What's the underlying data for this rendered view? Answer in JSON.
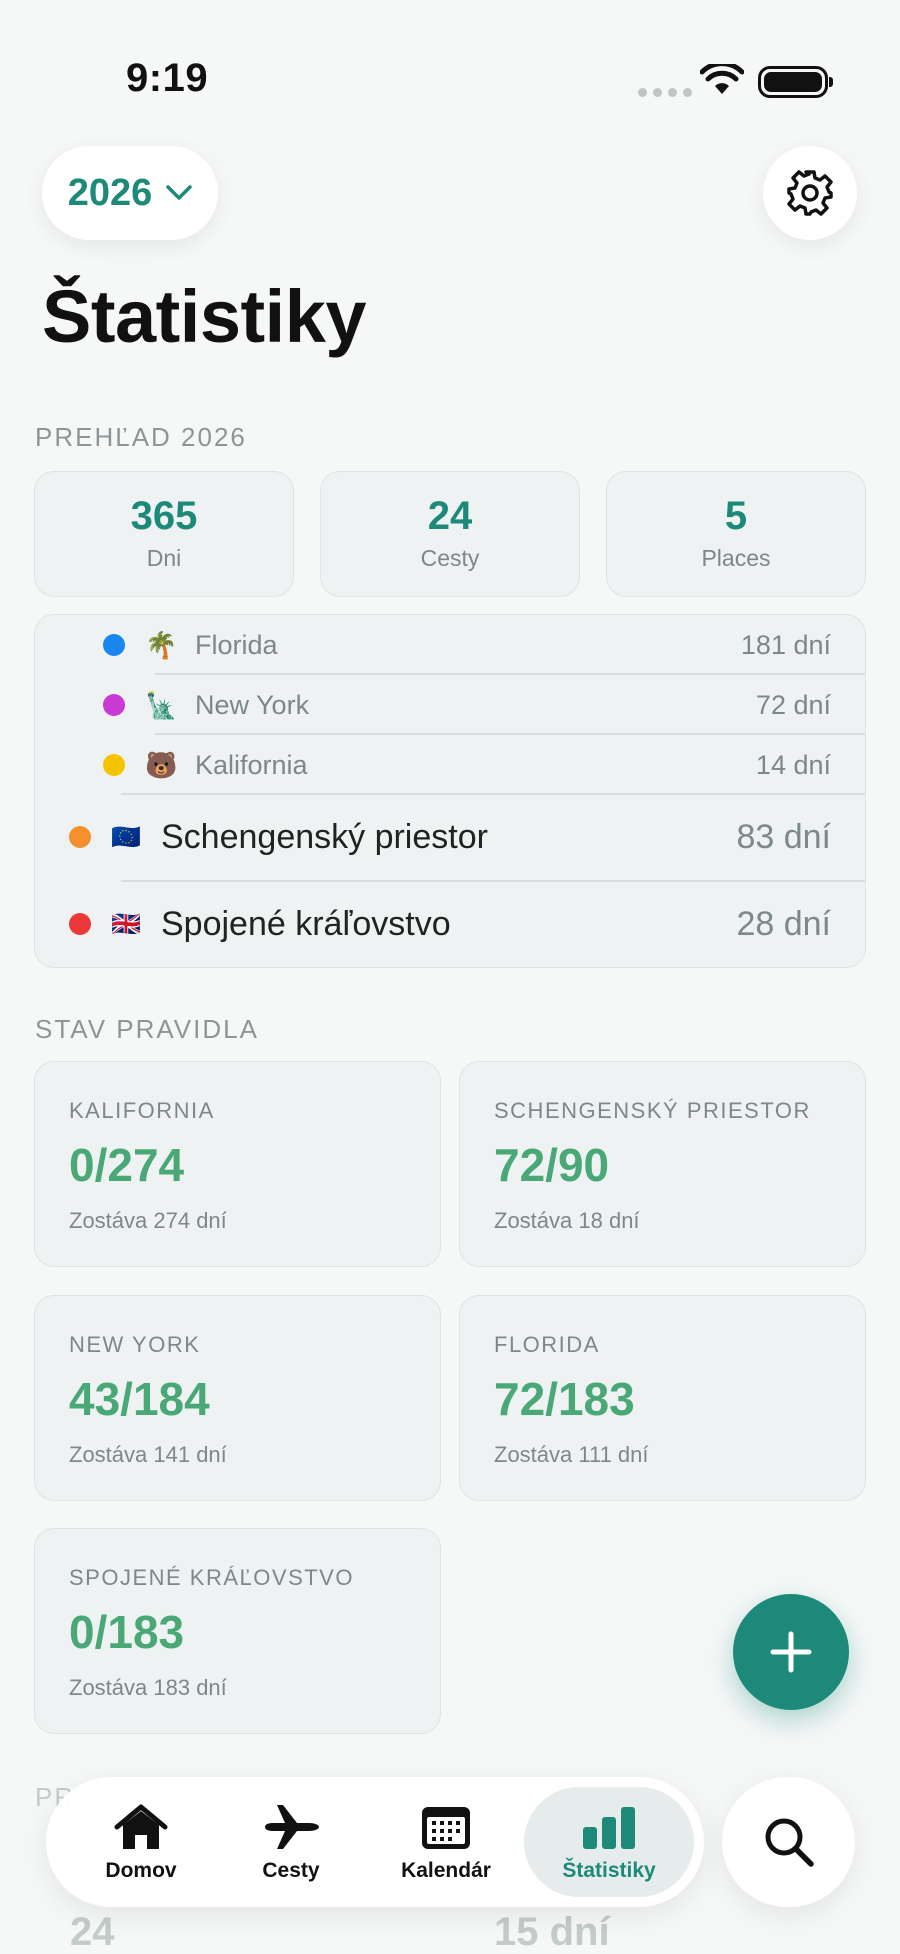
{
  "status_bar": {
    "time": "9:19"
  },
  "header": {
    "year": "2026",
    "title": "Štatistiky"
  },
  "overview": {
    "label": "PREHĽAD 2026",
    "stats": [
      {
        "value": "365",
        "caption": "Dni"
      },
      {
        "value": "24",
        "caption": "Cesty"
      },
      {
        "value": "5",
        "caption": "Places"
      }
    ]
  },
  "places": [
    {
      "color": "#1a86f0",
      "flag": "🌴",
      "name": "Florida",
      "days": "181 dní",
      "level": "sub"
    },
    {
      "color": "#c93bd4",
      "flag": "🗽",
      "name": "New York",
      "days": "72 dní",
      "level": "sub"
    },
    {
      "color": "#f5c400",
      "flag": "🐻",
      "name": "Kalifornia",
      "days": "14 dní",
      "level": "sub"
    },
    {
      "color": "#f5902e",
      "flag": "🇪🇺",
      "name": "Schengenský priestor",
      "days": "83 dní",
      "level": "main"
    },
    {
      "color": "#eb3838",
      "flag": "🇬🇧",
      "name": "Spojené kráľovstvo",
      "days": "28 dní",
      "level": "main"
    }
  ],
  "rules": {
    "label": "STAV PRAVIDLA",
    "cards": [
      {
        "title": "KALIFORNIA",
        "value": "0/274",
        "remaining": "Zostáva 274 dní"
      },
      {
        "title": "SCHENGENSKÝ PRIESTOR",
        "value": "72/90",
        "remaining": "Zostáva 18 dní"
      },
      {
        "title": "NEW YORK",
        "value": "43/184",
        "remaining": "Zostáva 141 dní"
      },
      {
        "title": "FLORIDA",
        "value": "72/183",
        "remaining": "Zostáva 111 dní"
      },
      {
        "title": "SPOJENÉ KRÁĽOVSTVO",
        "value": "0/183",
        "remaining": "Zostáva 183 dní"
      }
    ]
  },
  "faded": {
    "label": "PR",
    "left_value": "24",
    "right_value": "15 dní"
  },
  "tabs": [
    {
      "label": "Domov",
      "icon": "house-icon"
    },
    {
      "label": "Cesty",
      "icon": "airplane-icon"
    },
    {
      "label": "Kalendár",
      "icon": "calendar-icon"
    },
    {
      "label": "Štatistiky",
      "icon": "chart-bar-icon",
      "active": true
    }
  ],
  "colors": {
    "accent": "#1d8a79",
    "rule_value": "#4aa876"
  }
}
